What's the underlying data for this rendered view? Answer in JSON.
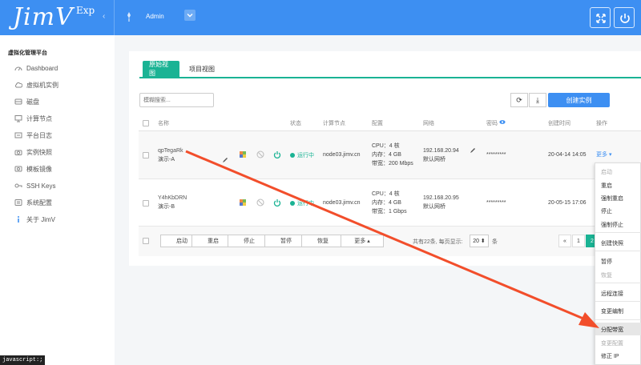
{
  "header": {
    "logo": "JimV",
    "logo_sup": "Exp",
    "collapse": "‹",
    "user": "Admin",
    "dropdown": "⌄"
  },
  "sidebar": {
    "title": "虚拟化管理平台",
    "items": [
      {
        "label": "Dashboard",
        "icon": "dashboard-icon"
      },
      {
        "label": "虚拟机实例",
        "icon": "cloud-icon"
      },
      {
        "label": "磁盘",
        "icon": "disk-icon"
      },
      {
        "label": "计算节点",
        "icon": "monitor-icon"
      },
      {
        "label": "平台日志",
        "icon": "log-icon"
      },
      {
        "label": "实例快照",
        "icon": "camera-icon"
      },
      {
        "label": "模板镜像",
        "icon": "image-icon"
      },
      {
        "label": "SSH Keys",
        "icon": "key-icon"
      },
      {
        "label": "系统配置",
        "icon": "settings-icon"
      },
      {
        "label": "关于 JimV",
        "icon": "info-icon"
      }
    ]
  },
  "tabs": [
    {
      "label": "原始视图",
      "active": true
    },
    {
      "label": "项目视图",
      "active": false
    }
  ],
  "search": {
    "placeholder": "模糊搜索..."
  },
  "toolbar": {
    "refresh": "⟳",
    "download": "⤓",
    "create": "创建实例"
  },
  "table": {
    "headers": [
      "名称",
      "状态",
      "计算节点",
      "配置",
      "网络",
      "密码",
      "创建时间",
      "操作"
    ],
    "rows": [
      {
        "name": "qpTegaRk",
        "label": "演示-A",
        "status": "运行中",
        "node": "node03.jimv.cn",
        "cpu": "CPU：4 核",
        "mem": "内存：4 GB",
        "bw": "带宽：200 Mbps",
        "ip": "192.168.20.94",
        "net": "默认网桥",
        "password": "*********",
        "created": "20-04-14 14:05",
        "action": "更多 ▾"
      },
      {
        "name": "Y4hKbDRN",
        "label": "演示-B",
        "status": "运行中",
        "node": "node03.jimv.cn",
        "cpu": "CPU：4 核",
        "mem": "内存：4 GB",
        "bw": "带宽：1 Gbps",
        "ip": "192.168.20.95",
        "net": "默认网桥",
        "password": "*********",
        "created": "20-05-15 17:06",
        "action": ""
      }
    ]
  },
  "bulk": {
    "buttons": [
      "启动",
      "重启",
      "停止",
      "暂停",
      "恢复",
      "更多 ▴"
    ],
    "total_text": "共有22条, 每页显示:",
    "page_size": "20 ⬍",
    "unit": "条"
  },
  "pagination": {
    "prev": "«",
    "page1": "1",
    "page2": "2"
  },
  "menu": {
    "items": [
      {
        "label": "启动",
        "state": "disabled"
      },
      {
        "label": "重启",
        "state": "normal"
      },
      {
        "label": "强制重启",
        "state": "normal"
      },
      {
        "label": "停止",
        "state": "normal"
      },
      {
        "label": "强制停止",
        "state": "normal"
      },
      {
        "label": "创建快照",
        "state": "normal"
      },
      {
        "label": "暂停",
        "state": "normal"
      },
      {
        "label": "恢复",
        "state": "disabled"
      },
      {
        "label": "远程连接",
        "state": "normal"
      },
      {
        "label": "变更编制",
        "state": "normal"
      },
      {
        "label": "分配带宽",
        "state": "highlight"
      },
      {
        "label": "变更配置",
        "state": "disabled"
      },
      {
        "label": "修正 IP",
        "state": "normal"
      }
    ]
  },
  "statusbar": "javascript:;",
  "colors": {
    "primary": "#3d8ff2",
    "accent": "#1ab394",
    "arrow": "#f24e2b"
  }
}
